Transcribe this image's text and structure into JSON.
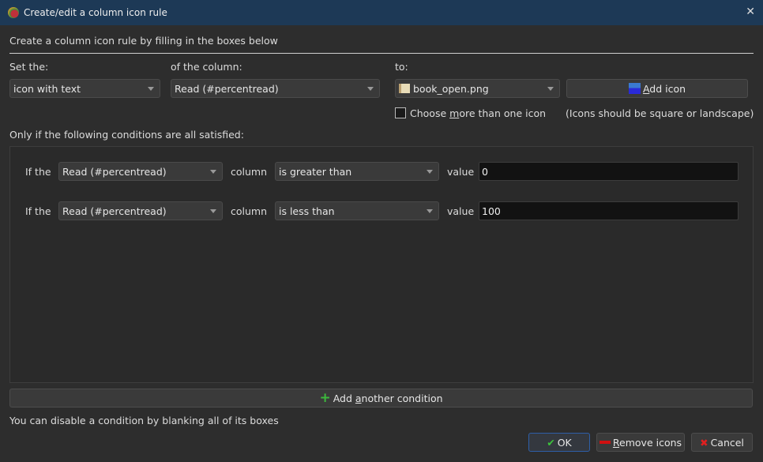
{
  "window": {
    "title": "Create/edit a column icon rule",
    "close": "✕"
  },
  "intro": "Create a column icon rule by filling in the boxes below",
  "labels": {
    "set_the": "Set the:",
    "of_column": "of the column:",
    "to": "to:"
  },
  "kind": "icon with text",
  "column": "Read (#percentread)",
  "icon_file": "book_open.png",
  "add_icon": {
    "pre": "",
    "ul": "A",
    "post": "dd icon"
  },
  "multi": {
    "pre": "Choose ",
    "ul": "m",
    "post": "ore than one icon",
    "checked": false
  },
  "icons_hint": "(Icons should be square or landscape)",
  "conditions_label": "Only if the following conditions are all satisfied:",
  "conditions": [
    {
      "if": "If the",
      "column": "Read (#percentread)",
      "col_word": "column",
      "op": "is greater than",
      "val_word": "value",
      "value": "0"
    },
    {
      "if": "If the",
      "column": "Read (#percentread)",
      "col_word": "column",
      "op": "is less than",
      "val_word": "value",
      "value": "100"
    }
  ],
  "add_condition": {
    "pre": "Add ",
    "ul": "a",
    "post": "nother condition"
  },
  "footer_hint": "You can disable a condition by blanking all of its boxes",
  "buttons": {
    "ok": "OK",
    "remove": {
      "ul": "R",
      "post": "emove icons"
    },
    "cancel": "Cancel"
  }
}
